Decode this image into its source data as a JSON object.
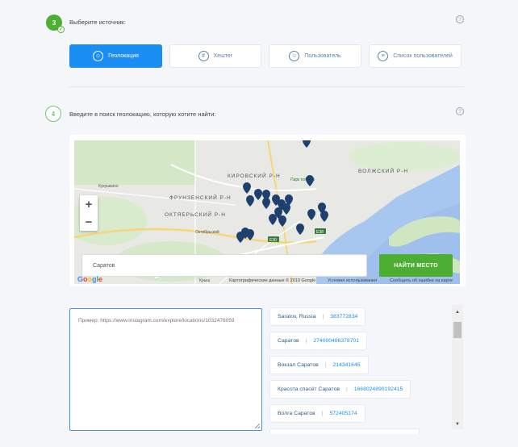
{
  "step3": {
    "number": "3",
    "title": "Выберите источник:",
    "help": "?",
    "sources": [
      {
        "label": "Геолокация",
        "icon": "location-pin-icon",
        "active": true
      },
      {
        "label": "Хештег",
        "icon": "hash-icon",
        "active": false
      },
      {
        "label": "Пользователь",
        "icon": "user-icon",
        "active": false
      },
      {
        "label": "Список пользователей",
        "icon": "list-icon",
        "active": false
      }
    ]
  },
  "step4": {
    "number": "4",
    "title": "Введите в поиск геолокацию, которую хотите найти:",
    "help": "?"
  },
  "map": {
    "districts": [
      "КИРОВСКИЙ Р-Н",
      "ФРУНЗЕНСКИЙ Р-Н",
      "ОКТЯБРЬСКИЙ Р-Н",
      "ВОЛЖСКИЙ Р-Н"
    ],
    "labels": [
      "Парк победы",
      "Октябрьский",
      "Кукушкино",
      "Крыш"
    ],
    "road_badges": [
      "E38",
      "E30"
    ],
    "zoom_in": "+",
    "zoom_out": "−",
    "search_value": "Саратов",
    "find_button": "НАЙТИ МЕСТО",
    "google": "Google",
    "footer_data": "Картографические данные © 2019 Google",
    "footer_terms": "Условия использования",
    "footer_report": "Сообщить об ошибке на карте"
  },
  "url_input": {
    "placeholder": "Пример: https://www.instagram.com/explore/locations/1032476059"
  },
  "results": [
    {
      "name": "Saratov, Russia",
      "id": "383772834"
    },
    {
      "name": "Саратов",
      "id": "274000486378701"
    },
    {
      "name": "Вокзал Саратов",
      "id": "214341645"
    },
    {
      "name": "Красота спасёт Саратов",
      "id": "1668024890192415"
    },
    {
      "name": "Волга Саратов",
      "id": "572405174"
    }
  ],
  "colors": {
    "accent_blue": "#1a8ef2",
    "accent_green": "#4caf32",
    "pin": "#1f3f6e",
    "water": "#a8c7f0"
  }
}
